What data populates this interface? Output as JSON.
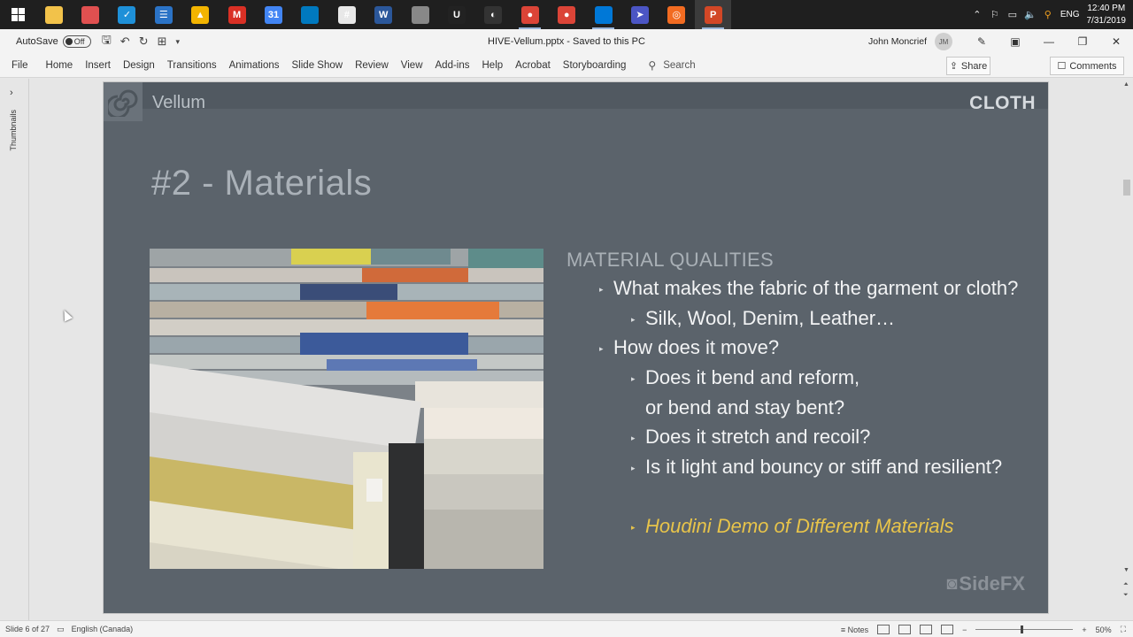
{
  "taskbar": {
    "apps": [
      {
        "name": "file-explorer-icon",
        "color": "#f2c24a",
        "glyph": "",
        "running": false
      },
      {
        "name": "cleaner-app-icon",
        "color": "#e05050",
        "glyph": "",
        "running": false
      },
      {
        "name": "todo-app-icon",
        "color": "#1e90d8",
        "glyph": "✓",
        "running": false
      },
      {
        "name": "notes-app-icon",
        "color": "#2b73c6",
        "glyph": "☰",
        "running": false
      },
      {
        "name": "google-drive-icon",
        "color": "#f3b400",
        "glyph": "▲",
        "running": false
      },
      {
        "name": "gmail-icon",
        "color": "#d93025",
        "glyph": "M",
        "running": false
      },
      {
        "name": "google-calendar-icon",
        "color": "#4285f4",
        "glyph": "31",
        "running": false
      },
      {
        "name": "trello-icon",
        "color": "#0079bf",
        "glyph": "",
        "running": false
      },
      {
        "name": "slack-icon",
        "color": "#e8e8e8",
        "glyph": "#",
        "running": false
      },
      {
        "name": "word-icon",
        "color": "#2b579a",
        "glyph": "W",
        "running": false
      },
      {
        "name": "scanner-app-icon",
        "color": "#888888",
        "glyph": "",
        "running": false
      },
      {
        "name": "unreal-engine-icon",
        "color": "#222222",
        "glyph": "U",
        "running": false
      },
      {
        "name": "obs-studio-icon",
        "color": "#333333",
        "glyph": "◐",
        "running": false
      },
      {
        "name": "chrome-icon",
        "color": "#db4437",
        "glyph": "●",
        "running": true
      },
      {
        "name": "chrome-profile-icon",
        "color": "#db4437",
        "glyph": "●",
        "running": false
      },
      {
        "name": "remote-desktop-icon",
        "color": "#0078d7",
        "glyph": "",
        "running": true
      },
      {
        "name": "telegram-app-icon",
        "color": "#4b55c4",
        "glyph": "➤",
        "running": false
      },
      {
        "name": "houdini-icon",
        "color": "#f26b21",
        "glyph": "◎",
        "running": false
      },
      {
        "name": "powerpoint-icon",
        "color": "#d24726",
        "glyph": "P",
        "running": true
      }
    ],
    "language": "ENG",
    "time": "12:40 PM",
    "date": "7/31/2019"
  },
  "titlebar": {
    "autosave_label": "AutoSave",
    "autosave_state": "Off",
    "document_title": "HIVE-Vellum.pptx  -  Saved to this PC",
    "user_name": "John Moncrief",
    "user_initials": "JM"
  },
  "ribbon": {
    "tabs": [
      "File",
      "Home",
      "Insert",
      "Design",
      "Transitions",
      "Animations",
      "Slide Show",
      "Review",
      "View",
      "Add-ins",
      "Help",
      "Acrobat",
      "Storyboarding"
    ],
    "search_label": "Search",
    "share_label": "Share",
    "comments_label": "Comments"
  },
  "thumbnails_label": "Thumbnails",
  "slide": {
    "brand": "Vellum",
    "section": "CLOTH",
    "title": "#2 - Materials",
    "heading": "MATERIAL QUALITIES",
    "bullets": [
      "What makes the fabric of the garment or cloth?",
      "Silk, Wool, Denim, Leather…",
      "How does it move?",
      "Does it bend and reform,",
      "or bend and stay bent?",
      "Does it stretch and recoil?",
      "Is it light and bouncy or stiff and resilient?",
      "Houdini Demo of Different Materials"
    ],
    "footer_logo": "SideFX",
    "accent_color": "#e8c44a",
    "background_color": "#5b636b"
  },
  "statusbar": {
    "slide_info": "Slide 6 of 27",
    "language": "English (Canada)",
    "notes_label": "Notes",
    "zoom": "50%"
  }
}
